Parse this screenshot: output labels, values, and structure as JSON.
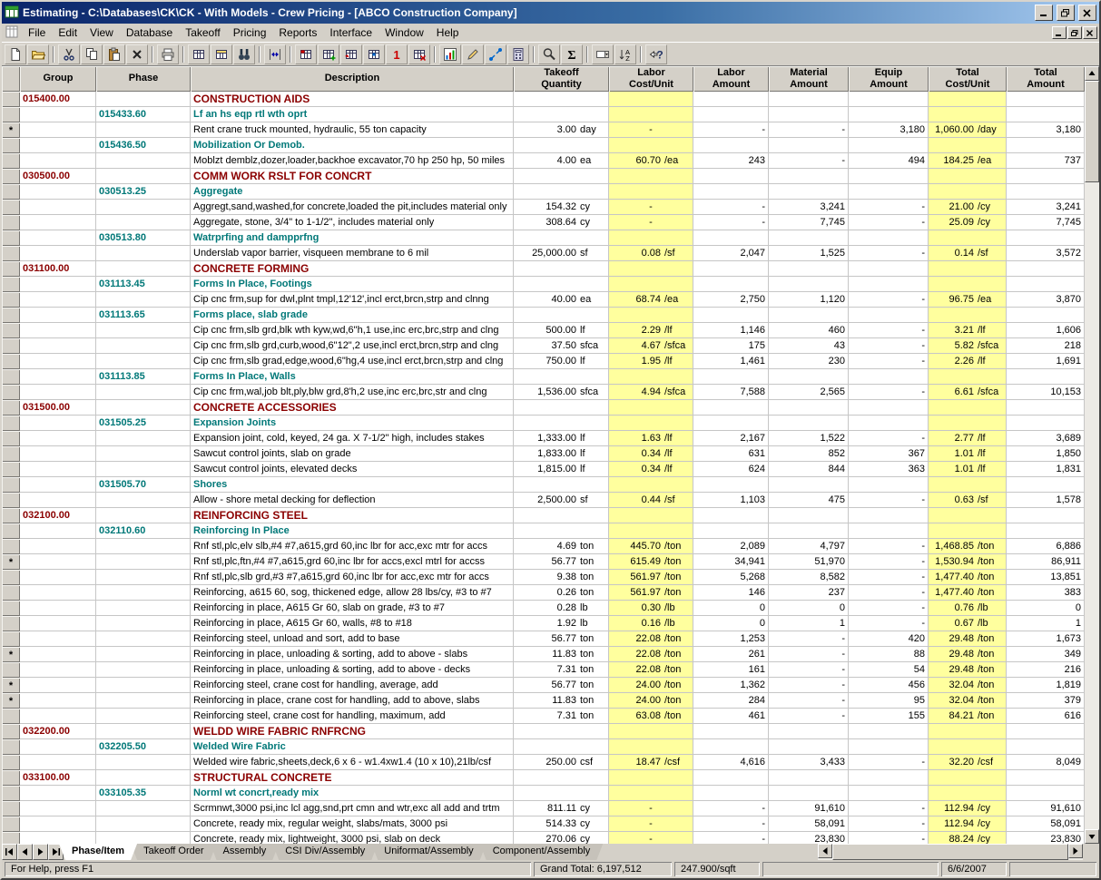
{
  "window": {
    "title": "Estimating - C:\\Databases\\CK\\CK - With Models - Crew Pricing - [ABCO Construction Company]"
  },
  "menu": {
    "items": [
      "File",
      "Edit",
      "View",
      "Database",
      "Takeoff",
      "Pricing",
      "Reports",
      "Interface",
      "Window",
      "Help"
    ]
  },
  "toolbar": {
    "buttons": [
      "new-document-icon",
      "open-folder-icon",
      "sep",
      "cut-icon",
      "copy-icon",
      "paste-icon",
      "delete-icon",
      "sep",
      "print-icon",
      "sep",
      "view-sheet-icon",
      "view-detail-icon",
      "find-icon",
      "sep",
      "column-width-icon",
      "sep",
      "takeoff-sheet-icon",
      "takeoff-add-icon",
      "takeoff-insert-icon",
      "takeoff-fill-icon",
      "single-item-icon",
      "takeoff-remove-icon",
      "sep",
      "chart-icon",
      "pencil-icon",
      "link-icon",
      "calculator-icon",
      "sep",
      "zoom-icon",
      "sum-icon",
      "sep",
      "combo-box-icon",
      "sort-icon",
      "sep",
      "help-icon"
    ]
  },
  "grid": {
    "headers": [
      "",
      "Group",
      "Phase",
      "Description",
      "Takeoff\nQuantity",
      "Labor\nCost/Unit",
      "Labor\nAmount",
      "Material\nAmount",
      "Equip\nAmount",
      "Total\nCost/Unit",
      "Total\nAmount"
    ],
    "accent_yellow": "#ffff9e",
    "group_color": "#8b0000",
    "phase_color": "#007878",
    "rows": [
      {
        "t": "group",
        "g": "015400.00",
        "d": "CONSTRUCTION AIDS"
      },
      {
        "t": "phase",
        "p": "015433.60",
        "d": "Lf an hs eqp rtl wth oprt"
      },
      {
        "t": "item",
        "s": true,
        "d": "Rent crane truck mounted, hydraulic, 55 ton capacity",
        "q": "3.00",
        "qu": "day",
        "l": "-",
        "lu": "",
        "la": "-",
        "ma": "-",
        "ea": "3,180",
        "tc": "1,060.00",
        "tu": "/day",
        "ta": "3,180"
      },
      {
        "t": "phase",
        "p": "015436.50",
        "d": "Mobilization Or Demob."
      },
      {
        "t": "item",
        "d": "Moblzt demblz,dozer,loader,backhoe excavator,70 hp 250 hp, 50 miles",
        "q": "4.00",
        "qu": "ea",
        "l": "60.70",
        "lu": "/ea",
        "la": "243",
        "ma": "-",
        "ea": "494",
        "tc": "184.25",
        "tu": "/ea",
        "ta": "737"
      },
      {
        "t": "group",
        "g": "030500.00",
        "d": "COMM WORK RSLT FOR CONCRT"
      },
      {
        "t": "phase",
        "p": "030513.25",
        "d": "Aggregate"
      },
      {
        "t": "item",
        "d": "Aggregt,sand,washed,for concrete,loaded the pit,includes material only",
        "q": "154.32",
        "qu": "cy",
        "l": "-",
        "lu": "",
        "la": "-",
        "ma": "3,241",
        "ea": "-",
        "tc": "21.00",
        "tu": "/cy",
        "ta": "3,241"
      },
      {
        "t": "item",
        "d": "Aggregate, stone, 3/4\" to 1-1/2\", includes material only",
        "q": "308.64",
        "qu": "cy",
        "l": "-",
        "lu": "",
        "la": "-",
        "ma": "7,745",
        "ea": "-",
        "tc": "25.09",
        "tu": "/cy",
        "ta": "7,745"
      },
      {
        "t": "phase",
        "p": "030513.80",
        "d": "Watrprfing and dampprfng"
      },
      {
        "t": "item",
        "d": "Underslab vapor barrier, visqueen membrane to 6 mil",
        "q": "25,000.00",
        "qu": "sf",
        "l": "0.08",
        "lu": "/sf",
        "la": "2,047",
        "ma": "1,525",
        "ea": "-",
        "tc": "0.14",
        "tu": "/sf",
        "ta": "3,572"
      },
      {
        "t": "group",
        "g": "031100.00",
        "d": "CONCRETE FORMING"
      },
      {
        "t": "phase",
        "p": "031113.45",
        "d": "Forms In Place, Footings"
      },
      {
        "t": "item",
        "d": "Cip cnc frm,sup for dwl,plnt tmpl,12'12',incl erct,brcn,strp and clnng",
        "q": "40.00",
        "qu": "ea",
        "l": "68.74",
        "lu": "/ea",
        "la": "2,750",
        "ma": "1,120",
        "ea": "-",
        "tc": "96.75",
        "tu": "/ea",
        "ta": "3,870"
      },
      {
        "t": "phase",
        "p": "031113.65",
        "d": "Forms place, slab grade"
      },
      {
        "t": "item",
        "d": "Cip cnc frm,slb grd,blk wth kyw,wd,6\"h,1 use,inc erc,brc,strp and clng",
        "q": "500.00",
        "qu": "lf",
        "l": "2.29",
        "lu": "/lf",
        "la": "1,146",
        "ma": "460",
        "ea": "-",
        "tc": "3.21",
        "tu": "/lf",
        "ta": "1,606"
      },
      {
        "t": "item",
        "d": "Cip cnc frm,slb grd,curb,wood,6\"12\",2 use,incl erct,brcn,strp and clng",
        "q": "37.50",
        "qu": "sfca",
        "l": "4.67",
        "lu": "/sfca",
        "la": "175",
        "ma": "43",
        "ea": "-",
        "tc": "5.82",
        "tu": "/sfca",
        "ta": "218"
      },
      {
        "t": "item",
        "d": "Cip cnc frm,slb grad,edge,wood,6\"hg,4 use,incl erct,brcn,strp and clng",
        "q": "750.00",
        "qu": "lf",
        "l": "1.95",
        "lu": "/lf",
        "la": "1,461",
        "ma": "230",
        "ea": "-",
        "tc": "2.26",
        "tu": "/lf",
        "ta": "1,691"
      },
      {
        "t": "phase",
        "p": "031113.85",
        "d": "Forms In Place, Walls"
      },
      {
        "t": "item",
        "d": "Cip cnc frm,wal,job blt,ply,blw grd,8'h,2 use,inc erc,brc,str and clng",
        "q": "1,536.00",
        "qu": "sfca",
        "l": "4.94",
        "lu": "/sfca",
        "la": "7,588",
        "ma": "2,565",
        "ea": "-",
        "tc": "6.61",
        "tu": "/sfca",
        "ta": "10,153"
      },
      {
        "t": "group",
        "g": "031500.00",
        "d": "CONCRETE ACCESSORIES"
      },
      {
        "t": "phase",
        "p": "031505.25",
        "d": "Expansion Joints"
      },
      {
        "t": "item",
        "d": "Expansion joint, cold, keyed, 24 ga. X 7-1/2\" high, includes stakes",
        "q": "1,333.00",
        "qu": "lf",
        "l": "1.63",
        "lu": "/lf",
        "la": "2,167",
        "ma": "1,522",
        "ea": "-",
        "tc": "2.77",
        "tu": "/lf",
        "ta": "3,689"
      },
      {
        "t": "item",
        "d": "Sawcut control joints, slab on grade",
        "q": "1,833.00",
        "qu": "lf",
        "l": "0.34",
        "lu": "/lf",
        "la": "631",
        "ma": "852",
        "ea": "367",
        "tc": "1.01",
        "tu": "/lf",
        "ta": "1,850"
      },
      {
        "t": "item",
        "d": "Sawcut control joints, elevated decks",
        "q": "1,815.00",
        "qu": "lf",
        "l": "0.34",
        "lu": "/lf",
        "la": "624",
        "ma": "844",
        "ea": "363",
        "tc": "1.01",
        "tu": "/lf",
        "ta": "1,831"
      },
      {
        "t": "phase",
        "p": "031505.70",
        "d": "Shores"
      },
      {
        "t": "item",
        "d": "Allow - shore metal decking for deflection",
        "q": "2,500.00",
        "qu": "sf",
        "l": "0.44",
        "lu": "/sf",
        "la": "1,103",
        "ma": "475",
        "ea": "-",
        "tc": "0.63",
        "tu": "/sf",
        "ta": "1,578"
      },
      {
        "t": "group",
        "g": "032100.00",
        "d": "REINFORCING STEEL"
      },
      {
        "t": "phase",
        "p": "032110.60",
        "d": "Reinforcing In Place"
      },
      {
        "t": "item",
        "d": "Rnf stl,plc,elv slb,#4 #7,a615,grd 60,inc lbr for acc,exc mtr for accs",
        "q": "4.69",
        "qu": "ton",
        "l": "445.70",
        "lu": "/ton",
        "la": "2,089",
        "ma": "4,797",
        "ea": "-",
        "tc": "1,468.85",
        "tu": "/ton",
        "ta": "6,886"
      },
      {
        "t": "item",
        "s": true,
        "d": "Rnf stl,plc,ftn,#4 #7,a615,grd 60,inc lbr for accs,excl mtrl for accss",
        "q": "56.77",
        "qu": "ton",
        "l": "615.49",
        "lu": "/ton",
        "la": "34,941",
        "ma": "51,970",
        "ea": "-",
        "tc": "1,530.94",
        "tu": "/ton",
        "ta": "86,911"
      },
      {
        "t": "item",
        "d": "Rnf stl,plc,slb grd,#3 #7,a615,grd 60,inc lbr for acc,exc mtr for accs",
        "q": "9.38",
        "qu": "ton",
        "l": "561.97",
        "lu": "/ton",
        "la": "5,268",
        "ma": "8,582",
        "ea": "-",
        "tc": "1,477.40",
        "tu": "/ton",
        "ta": "13,851"
      },
      {
        "t": "item",
        "d": "Reinforcing, a615 60, sog, thickened edge, allow 28 lbs/cy, #3 to #7",
        "q": "0.26",
        "qu": "ton",
        "l": "561.97",
        "lu": "/ton",
        "la": "146",
        "ma": "237",
        "ea": "-",
        "tc": "1,477.40",
        "tu": "/ton",
        "ta": "383"
      },
      {
        "t": "item",
        "d": "Reinforcing in place, A615 Gr 60, slab on grade, #3 to #7",
        "q": "0.28",
        "qu": "lb",
        "l": "0.30",
        "lu": "/lb",
        "la": "0",
        "ma": "0",
        "ea": "-",
        "tc": "0.76",
        "tu": "/lb",
        "ta": "0"
      },
      {
        "t": "item",
        "d": "Reinforcing in place, A615 Gr 60, walls, #8 to #18",
        "q": "1.92",
        "qu": "lb",
        "l": "0.16",
        "lu": "/lb",
        "la": "0",
        "ma": "1",
        "ea": "-",
        "tc": "0.67",
        "tu": "/lb",
        "ta": "1"
      },
      {
        "t": "item",
        "d": "Reinforcing steel, unload and sort, add to base",
        "q": "56.77",
        "qu": "ton",
        "l": "22.08",
        "lu": "/ton",
        "la": "1,253",
        "ma": "-",
        "ea": "420",
        "tc": "29.48",
        "tu": "/ton",
        "ta": "1,673"
      },
      {
        "t": "item",
        "s": true,
        "d": "Reinforcing in place, unloading & sorting, add to above - slabs",
        "q": "11.83",
        "qu": "ton",
        "l": "22.08",
        "lu": "/ton",
        "la": "261",
        "ma": "-",
        "ea": "88",
        "tc": "29.48",
        "tu": "/ton",
        "ta": "349"
      },
      {
        "t": "item",
        "d": "Reinforcing in place, unloading & sorting, add to above - decks",
        "q": "7.31",
        "qu": "ton",
        "l": "22.08",
        "lu": "/ton",
        "la": "161",
        "ma": "-",
        "ea": "54",
        "tc": "29.48",
        "tu": "/ton",
        "ta": "216"
      },
      {
        "t": "item",
        "s": true,
        "d": "Reinforcing steel, crane cost for handling, average, add",
        "q": "56.77",
        "qu": "ton",
        "l": "24.00",
        "lu": "/ton",
        "la": "1,362",
        "ma": "-",
        "ea": "456",
        "tc": "32.04",
        "tu": "/ton",
        "ta": "1,819"
      },
      {
        "t": "item",
        "s": true,
        "d": "Reinforcing in place, crane cost for handling, add to above, slabs",
        "q": "11.83",
        "qu": "ton",
        "l": "24.00",
        "lu": "/ton",
        "la": "284",
        "ma": "-",
        "ea": "95",
        "tc": "32.04",
        "tu": "/ton",
        "ta": "379"
      },
      {
        "t": "item",
        "d": "Reinforcing steel, crane cost for handling, maximum, add",
        "q": "7.31",
        "qu": "ton",
        "l": "63.08",
        "lu": "/ton",
        "la": "461",
        "ma": "-",
        "ea": "155",
        "tc": "84.21",
        "tu": "/ton",
        "ta": "616"
      },
      {
        "t": "group",
        "g": "032200.00",
        "d": "WELDD WIRE FABRIC RNFRCNG"
      },
      {
        "t": "phase",
        "p": "032205.50",
        "d": "Welded Wire Fabric"
      },
      {
        "t": "item",
        "d": "Welded wire fabric,sheets,deck,6 x 6 - w1.4xw1.4 (10 x 10),21lb/csf",
        "q": "250.00",
        "qu": "csf",
        "l": "18.47",
        "lu": "/csf",
        "la": "4,616",
        "ma": "3,433",
        "ea": "-",
        "tc": "32.20",
        "tu": "/csf",
        "ta": "8,049"
      },
      {
        "t": "group",
        "g": "033100.00",
        "d": "STRUCTURAL CONCRETE"
      },
      {
        "t": "phase",
        "p": "033105.35",
        "d": "Norml wt concrt,ready mix"
      },
      {
        "t": "item",
        "d": "Scrmnwt,3000 psi,inc lcl agg,snd,prt cmn and wtr,exc all add and trtm",
        "q": "811.11",
        "qu": "cy",
        "l": "-",
        "lu": "",
        "la": "-",
        "ma": "91,610",
        "ea": "-",
        "tc": "112.94",
        "tu": "/cy",
        "ta": "91,610"
      },
      {
        "t": "item",
        "d": "Concrete, ready mix, regular weight, slabs/mats, 3000 psi",
        "q": "514.33",
        "qu": "cy",
        "l": "-",
        "lu": "",
        "la": "-",
        "ma": "58,091",
        "ea": "-",
        "tc": "112.94",
        "tu": "/cy",
        "ta": "58,091"
      },
      {
        "t": "item",
        "d": "Concrete, ready mix, lightweight, 3000 psi, slab on deck",
        "q": "270.06",
        "qu": "cy",
        "l": "-",
        "lu": "",
        "la": "-",
        "ma": "23,830",
        "ea": "-",
        "tc": "88.24",
        "tu": "/cy",
        "ta": "23,830"
      }
    ]
  },
  "tabs": {
    "items": [
      {
        "label": "Phase/Item",
        "active": true
      },
      {
        "label": "Takeoff Order",
        "active": false
      },
      {
        "label": "Assembly",
        "active": false
      },
      {
        "label": "CSI Div/Assembly",
        "active": false
      },
      {
        "label": "Uniformat/Assembly",
        "active": false
      },
      {
        "label": "Component/Assembly",
        "active": false
      }
    ]
  },
  "status": {
    "help": "For Help, press F1",
    "grand_total": "Grand Total: 6,197,512",
    "per_sqft": "247.900/sqft",
    "date": "6/6/2007"
  }
}
